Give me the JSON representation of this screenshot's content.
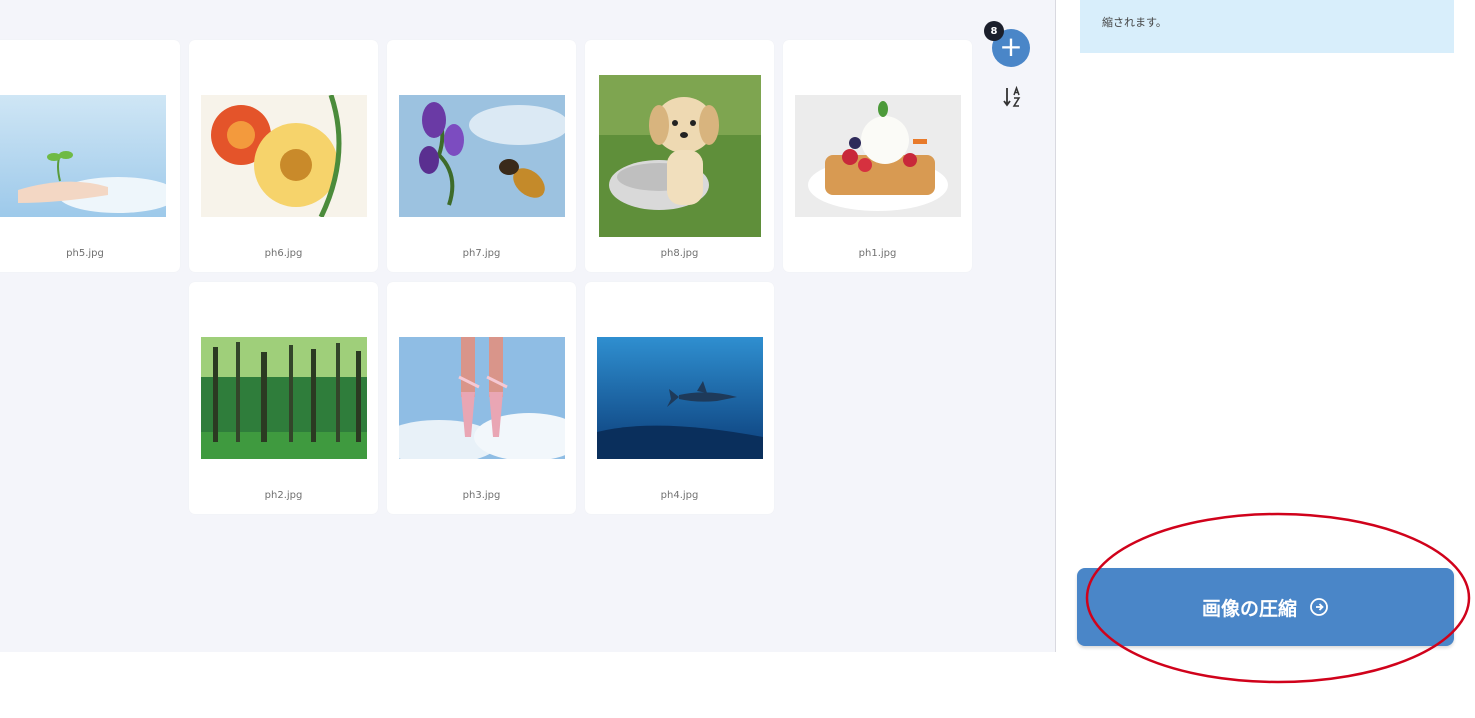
{
  "toolbar": {
    "add_icon": "plus-icon",
    "add_glyph": "+",
    "file_count": "8",
    "sort_icon": "sort-alpha-icon"
  },
  "gallery": {
    "items": [
      {
        "file": "ph5.jpg",
        "subject": "hand-holding-sprout"
      },
      {
        "file": "ph6.jpg",
        "subject": "flowers"
      },
      {
        "file": "ph7.jpg",
        "subject": "bee-and-iris"
      },
      {
        "file": "ph8.jpg",
        "subject": "puppy"
      },
      {
        "file": "ph1.jpg",
        "subject": "fruit-tart"
      },
      {
        "file": "ph2.jpg",
        "subject": "forest"
      },
      {
        "file": "ph3.jpg",
        "subject": "ballet-feet"
      },
      {
        "file": "ph4.jpg",
        "subject": "shark-underwater"
      }
    ]
  },
  "sidebar": {
    "info_text": "縮されます。",
    "compress_label": "画像の圧縮",
    "compress_icon": "circle-arrow-right-icon"
  },
  "colors": {
    "accent": "#4a86c8",
    "workspace_bg": "#f4f5fa",
    "info_bg": "#d8eefb",
    "annotation": "#d0021b"
  }
}
